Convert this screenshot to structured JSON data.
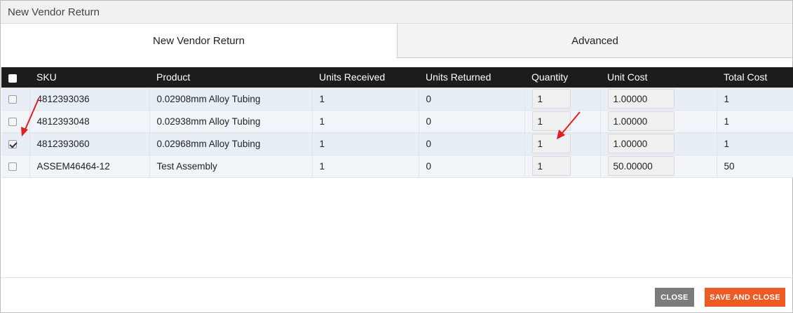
{
  "dialog": {
    "title": "New Vendor Return"
  },
  "tabs": [
    {
      "label": "New Vendor Return",
      "active": true
    },
    {
      "label": "Advanced",
      "active": false
    }
  ],
  "table": {
    "columns": [
      "SKU",
      "Product",
      "Units Received",
      "Units Returned",
      "Quantity",
      "Unit Cost",
      "Total Cost"
    ],
    "rows": [
      {
        "checked": false,
        "sku": "4812393036",
        "product": "0.02908mm Alloy Tubing",
        "units_received": "1",
        "units_returned": "0",
        "quantity": "1",
        "unit_cost": "1.00000",
        "total_cost": "1"
      },
      {
        "checked": false,
        "sku": "4812393048",
        "product": "0.02938mm Alloy Tubing",
        "units_received": "1",
        "units_returned": "0",
        "quantity": "1",
        "unit_cost": "1.00000",
        "total_cost": "1"
      },
      {
        "checked": true,
        "sku": "4812393060",
        "product": "0.02968mm Alloy Tubing",
        "units_received": "1",
        "units_returned": "0",
        "quantity": "1",
        "unit_cost": "1.00000",
        "total_cost": "1"
      },
      {
        "checked": false,
        "sku": "ASSEM46464-12",
        "product": "Test Assembly",
        "units_received": "1",
        "units_returned": "0",
        "quantity": "1",
        "unit_cost": "50.00000",
        "total_cost": "50"
      }
    ]
  },
  "footer": {
    "close_label": "CLOSE",
    "save_label": "SAVE AND CLOSE"
  },
  "colors": {
    "accent": "#ee5a24",
    "header_bg": "#1c1c1c",
    "annotation": "#e02020"
  }
}
